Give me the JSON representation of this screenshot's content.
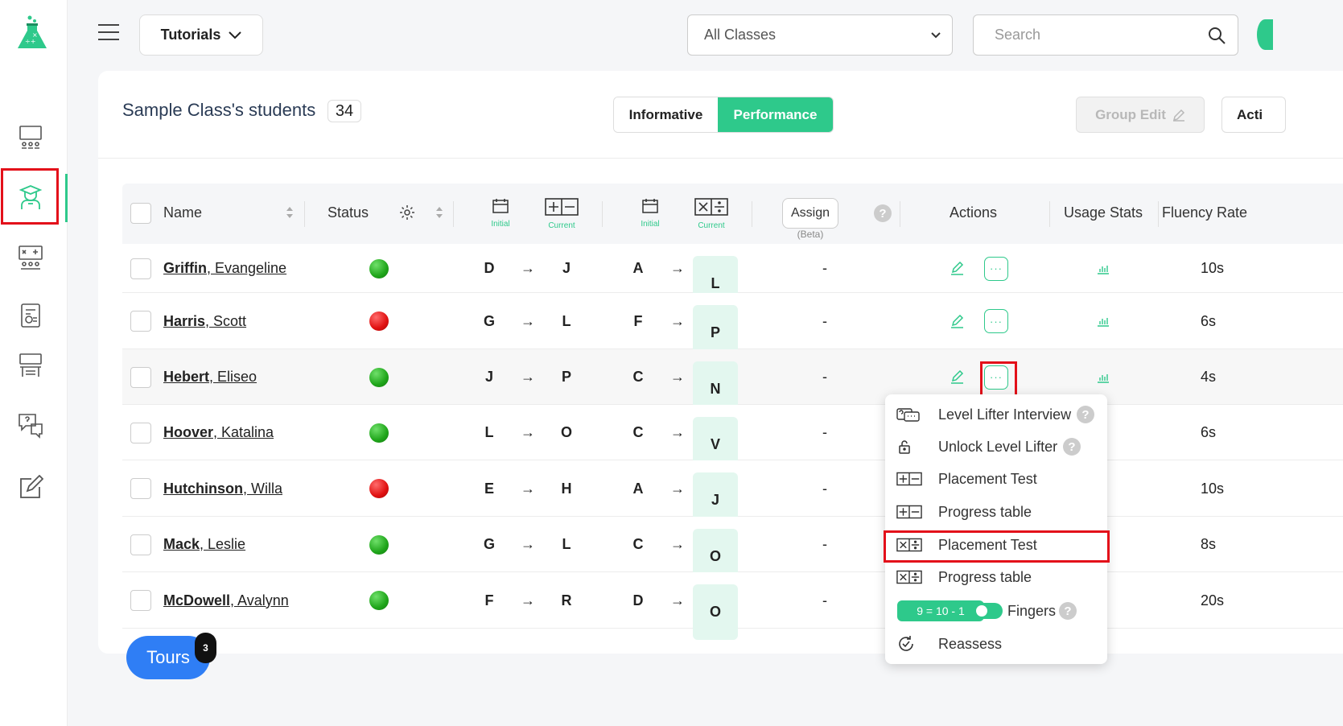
{
  "topbar": {
    "tutorials_label": "Tutorials",
    "class_select_value": "All Classes",
    "search_placeholder": "Search"
  },
  "header": {
    "title": "Sample Class's students",
    "student_count": "34",
    "toggle": {
      "informative": "Informative",
      "performance": "Performance"
    },
    "group_edit": "Group Edit",
    "actions_partial": "Acti"
  },
  "table": {
    "columns": {
      "name": "Name",
      "status": "Status",
      "initial": "Initial",
      "current": "Current",
      "assign": "Assign",
      "assign_beta": "(Beta)",
      "actions": "Actions",
      "usage_stats": "Usage Stats",
      "fluency_rate": "Fluency Rate"
    },
    "rows": [
      {
        "last": "Griffin",
        "first": ", Evangeline",
        "status": "green",
        "add_initial": "D",
        "add_current": "J",
        "mul_initial": "A",
        "mul_current": "L",
        "assign": "-",
        "fluency": "10s"
      },
      {
        "last": "Harris",
        "first": ", Scott",
        "status": "red",
        "add_initial": "G",
        "add_current": "L",
        "mul_initial": "F",
        "mul_current": "P",
        "assign": "-",
        "fluency": "6s"
      },
      {
        "last": "Hebert",
        "first": ", Eliseo",
        "status": "green",
        "add_initial": "J",
        "add_current": "P",
        "mul_initial": "C",
        "mul_current": "N",
        "assign": "-",
        "fluency": "4s"
      },
      {
        "last": "Hoover",
        "first": ", Katalina",
        "status": "green",
        "add_initial": "L",
        "add_current": "O",
        "mul_initial": "C",
        "mul_current": "V",
        "assign": "-",
        "fluency": "6s"
      },
      {
        "last": "Hutchinson",
        "first": ", Willa",
        "status": "red",
        "add_initial": "E",
        "add_current": "H",
        "mul_initial": "A",
        "mul_current": "J",
        "assign": "-",
        "fluency": "10s"
      },
      {
        "last": "Mack",
        "first": ", Leslie",
        "status": "green",
        "add_initial": "G",
        "add_current": "L",
        "mul_initial": "C",
        "mul_current": "O",
        "assign": "-",
        "fluency": "8s"
      },
      {
        "last": "McDowell",
        "first": ", Avalynn",
        "status": "green",
        "add_initial": "F",
        "add_current": "R",
        "mul_initial": "D",
        "mul_current": "O",
        "assign": "-",
        "fluency": "20s"
      }
    ]
  },
  "dropdown": {
    "items": [
      {
        "label": "Level Lifter Interview",
        "icon": "interview-icon"
      },
      {
        "label": "Unlock Level Lifter",
        "icon": "unlock-icon"
      },
      {
        "label": "Placement Test",
        "icon": "plus-minus-icon"
      },
      {
        "label": "Progress table",
        "icon": "plus-minus-icon"
      },
      {
        "label": "Placement Test",
        "icon": "times-divide-icon"
      },
      {
        "label": "Progress table",
        "icon": "times-divide-icon"
      },
      {
        "label": "Fingers",
        "icon": "switch"
      },
      {
        "label": "Reassess",
        "icon": "reassess-icon"
      }
    ],
    "equation_badge": "9 = 10 - 1"
  },
  "tours": {
    "label": "Tours",
    "badge": "3"
  },
  "colors": {
    "accent": "#2ec98b",
    "highlight": "#e3101a",
    "tours": "#2f7ef5"
  }
}
